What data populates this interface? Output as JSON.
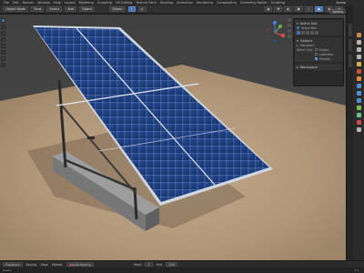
{
  "menubar": {
    "items": [
      "File",
      "Edit",
      "Render",
      "Window",
      "Help",
      "Layout",
      "Modeling",
      "Sculpting",
      "UV Editing",
      "Texture Paint",
      "Shading",
      "Animation",
      "Rendering",
      "Compositing",
      "Geometry Nodes",
      "Scripting"
    ],
    "scene": "Scene"
  },
  "header": {
    "mode": "Object Mode",
    "view": "View",
    "select": "Select",
    "add": "Add",
    "object": "Object",
    "orientation": "Global"
  },
  "options_label": "Options",
  "tool_panel": {
    "active_tool_label": "Active Tool",
    "select_box_label": "Select Box",
    "options_label": "Options",
    "transform_label": "Transform",
    "affect_only_label": "Affect Only",
    "origins_label": "Origins",
    "locations_label": "Locations",
    "parents_label": "Parents",
    "workspace_label": "Workspace"
  },
  "timeline": {
    "playback": "Playback",
    "keying": "Keying",
    "view": "View",
    "marker": "Marker",
    "auto_keying": "Auto Keying",
    "start_label": "Start",
    "start_value": "1",
    "end_label": "End",
    "end_value": "250"
  },
  "statusbar": {
    "hint": "Select",
    "version": "3.6"
  },
  "colors": {
    "accent": "#4772b3",
    "panel_cell": "#1b3a78",
    "ground": "#b49a7c"
  }
}
